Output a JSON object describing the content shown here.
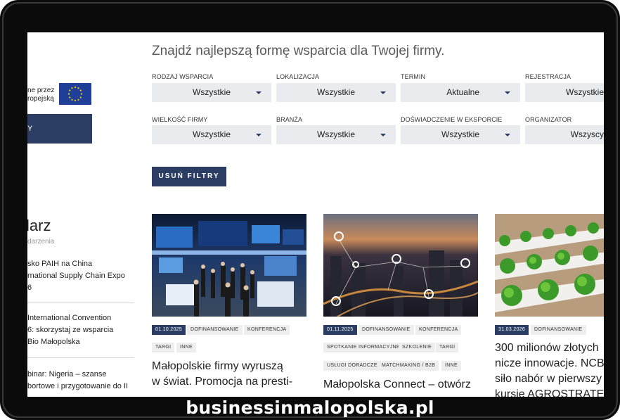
{
  "headline": "Znajdź najlepszą formę wsparcia dla Twojej firmy.",
  "sidebar": {
    "eu_text_line1": "ne przez",
    "eu_text_line2": "ropejską",
    "button_label": "Y",
    "calendar_title": "larz",
    "calendar_subtitle": "darzenia",
    "events": [
      {
        "lines": [
          "sko PAIH na China",
          "rnational Supply Chain Expo",
          "6"
        ]
      },
      {
        "lines": [
          "International Convention",
          "6: skorzystaj ze wsparcia",
          "Bio Małopolska"
        ]
      },
      {
        "lines": [
          "binar: Nigeria – szanse",
          "bortowe i przygotowanie do II"
        ]
      }
    ]
  },
  "filters": [
    {
      "label": "RODZAJ WSPARCIA",
      "value": "Wszystkie"
    },
    {
      "label": "LOKALIZACJA",
      "value": "Wszystkie"
    },
    {
      "label": "TERMIN",
      "value": "Aktualne"
    },
    {
      "label": "REJESTRACJA",
      "value": "Wszystkie"
    },
    {
      "label": "WIELKOŚĆ FIRMY",
      "value": "Wszystkie"
    },
    {
      "label": "BRANŻA",
      "value": "Wszystkie"
    },
    {
      "label": "DOŚWIADCZENIE W EKSPORCIE",
      "value": "Wszystkie"
    },
    {
      "label": "ORGANIZATOR",
      "value": "Wszyscy"
    }
  ],
  "clear_filters_label": "USUŃ FILTRY",
  "cards": [
    {
      "date": "01.10.2025",
      "tags_row1": [
        "DOFINANSOWANIE",
        "KONFERENCJA"
      ],
      "tags_row2": [
        "TARGI",
        "INNE"
      ],
      "tags_row3": [],
      "title_lines": [
        "Małopolskie firmy wyruszą",
        "w świat. Promocja na presti-"
      ]
    },
    {
      "date": "01.11.2025",
      "tags_row1": [
        "DOFINANSOWANIE",
        "KONFERENCJA"
      ],
      "tags_row2": [
        "SPOTKANIE INFORMACYJNE",
        "SZKOLENIE",
        "TARGI"
      ],
      "tags_row3": [
        "USŁUGI DORADCZE",
        "MATCHMAKING / B2B",
        "INNE"
      ],
      "title_lines": [
        "Małopolska Connect – otwórz"
      ]
    },
    {
      "date": "31.03.2026",
      "tags_row1": [
        "DOFINANSOWANIE"
      ],
      "tags_row2": [],
      "tags_row3": [],
      "title_lines": [
        "300 milionów złotych",
        "nicze innowacje. NCB",
        "siło nabór w pierwszy",
        "kursie AGROSTRATEG"
      ]
    }
  ],
  "banner_text": "businessinmalopolska.pl",
  "colors": {
    "navy": "#2b3d63",
    "select_bg": "#e9ebef",
    "eu_blue": "#1f3f99",
    "eu_star": "#f5d300"
  }
}
